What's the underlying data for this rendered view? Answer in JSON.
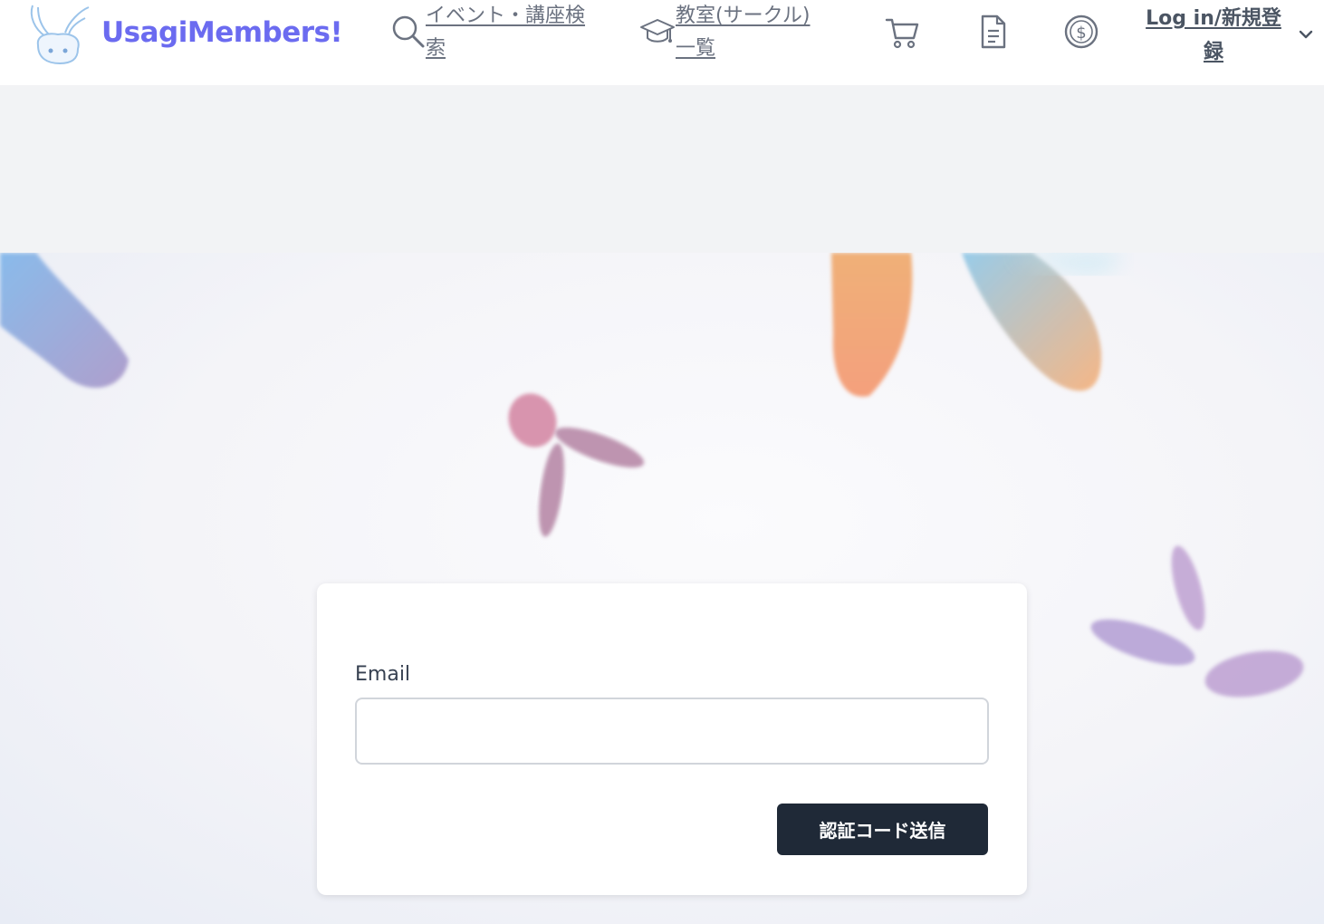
{
  "header": {
    "brand": "UsagiMembers!",
    "nav": {
      "events_label": "イベント・講座検索",
      "classes_label": "教室(サークル)一覧",
      "login_label": "Log in/新規登録"
    },
    "icons": [
      "rabbit-logo-icon",
      "search-icon",
      "graduation-cap-icon",
      "cart-icon",
      "document-icon",
      "dollar-icon",
      "chevron-down-icon"
    ]
  },
  "form": {
    "email_label": "Email",
    "email_value": "",
    "email_placeholder": "",
    "submit_label": "認証コード送信"
  },
  "colors": {
    "brand": "#6b6bf0",
    "button": "#1f2937",
    "background": "#f2f3f5"
  }
}
